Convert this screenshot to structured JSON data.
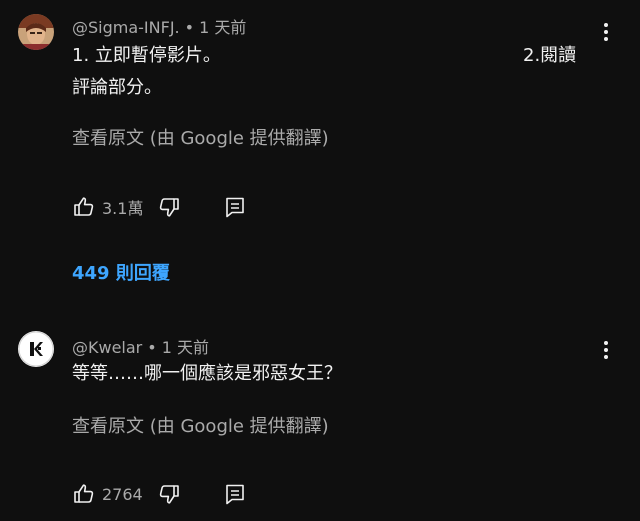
{
  "comments": [
    {
      "author": "@Sigma-INFJ.",
      "separator": "•",
      "time": "1 天前",
      "text_line1": "1. 立即暫停影片。",
      "text_line1_right": "2.閱讀",
      "text_line2": "評論部分。",
      "translate_label": "查看原文 (由 Google 提供翻譯)",
      "likes": "3.1萬",
      "replies_label": "449 則回覆",
      "avatar_icon": "profile-photo-icon"
    },
    {
      "author": "@Kwelar",
      "separator": "•",
      "time": "1 天前",
      "text_line1": "等等……哪一個應該是邪惡女王？",
      "translate_label": "查看原文 (由 Google 提供翻譯)",
      "likes": "2764",
      "avatar_icon": "kwelar-logo-icon"
    }
  ],
  "icons": {
    "like": "thumbs-up-icon",
    "dislike": "thumbs-down-icon",
    "reply": "reply-comment-icon",
    "menu": "more-vert-icon"
  },
  "colors": {
    "background": "#0f0f0f",
    "primary_text": "#f1f1f1",
    "secondary_text": "#aaaaaa",
    "link": "#3ea6ff"
  }
}
